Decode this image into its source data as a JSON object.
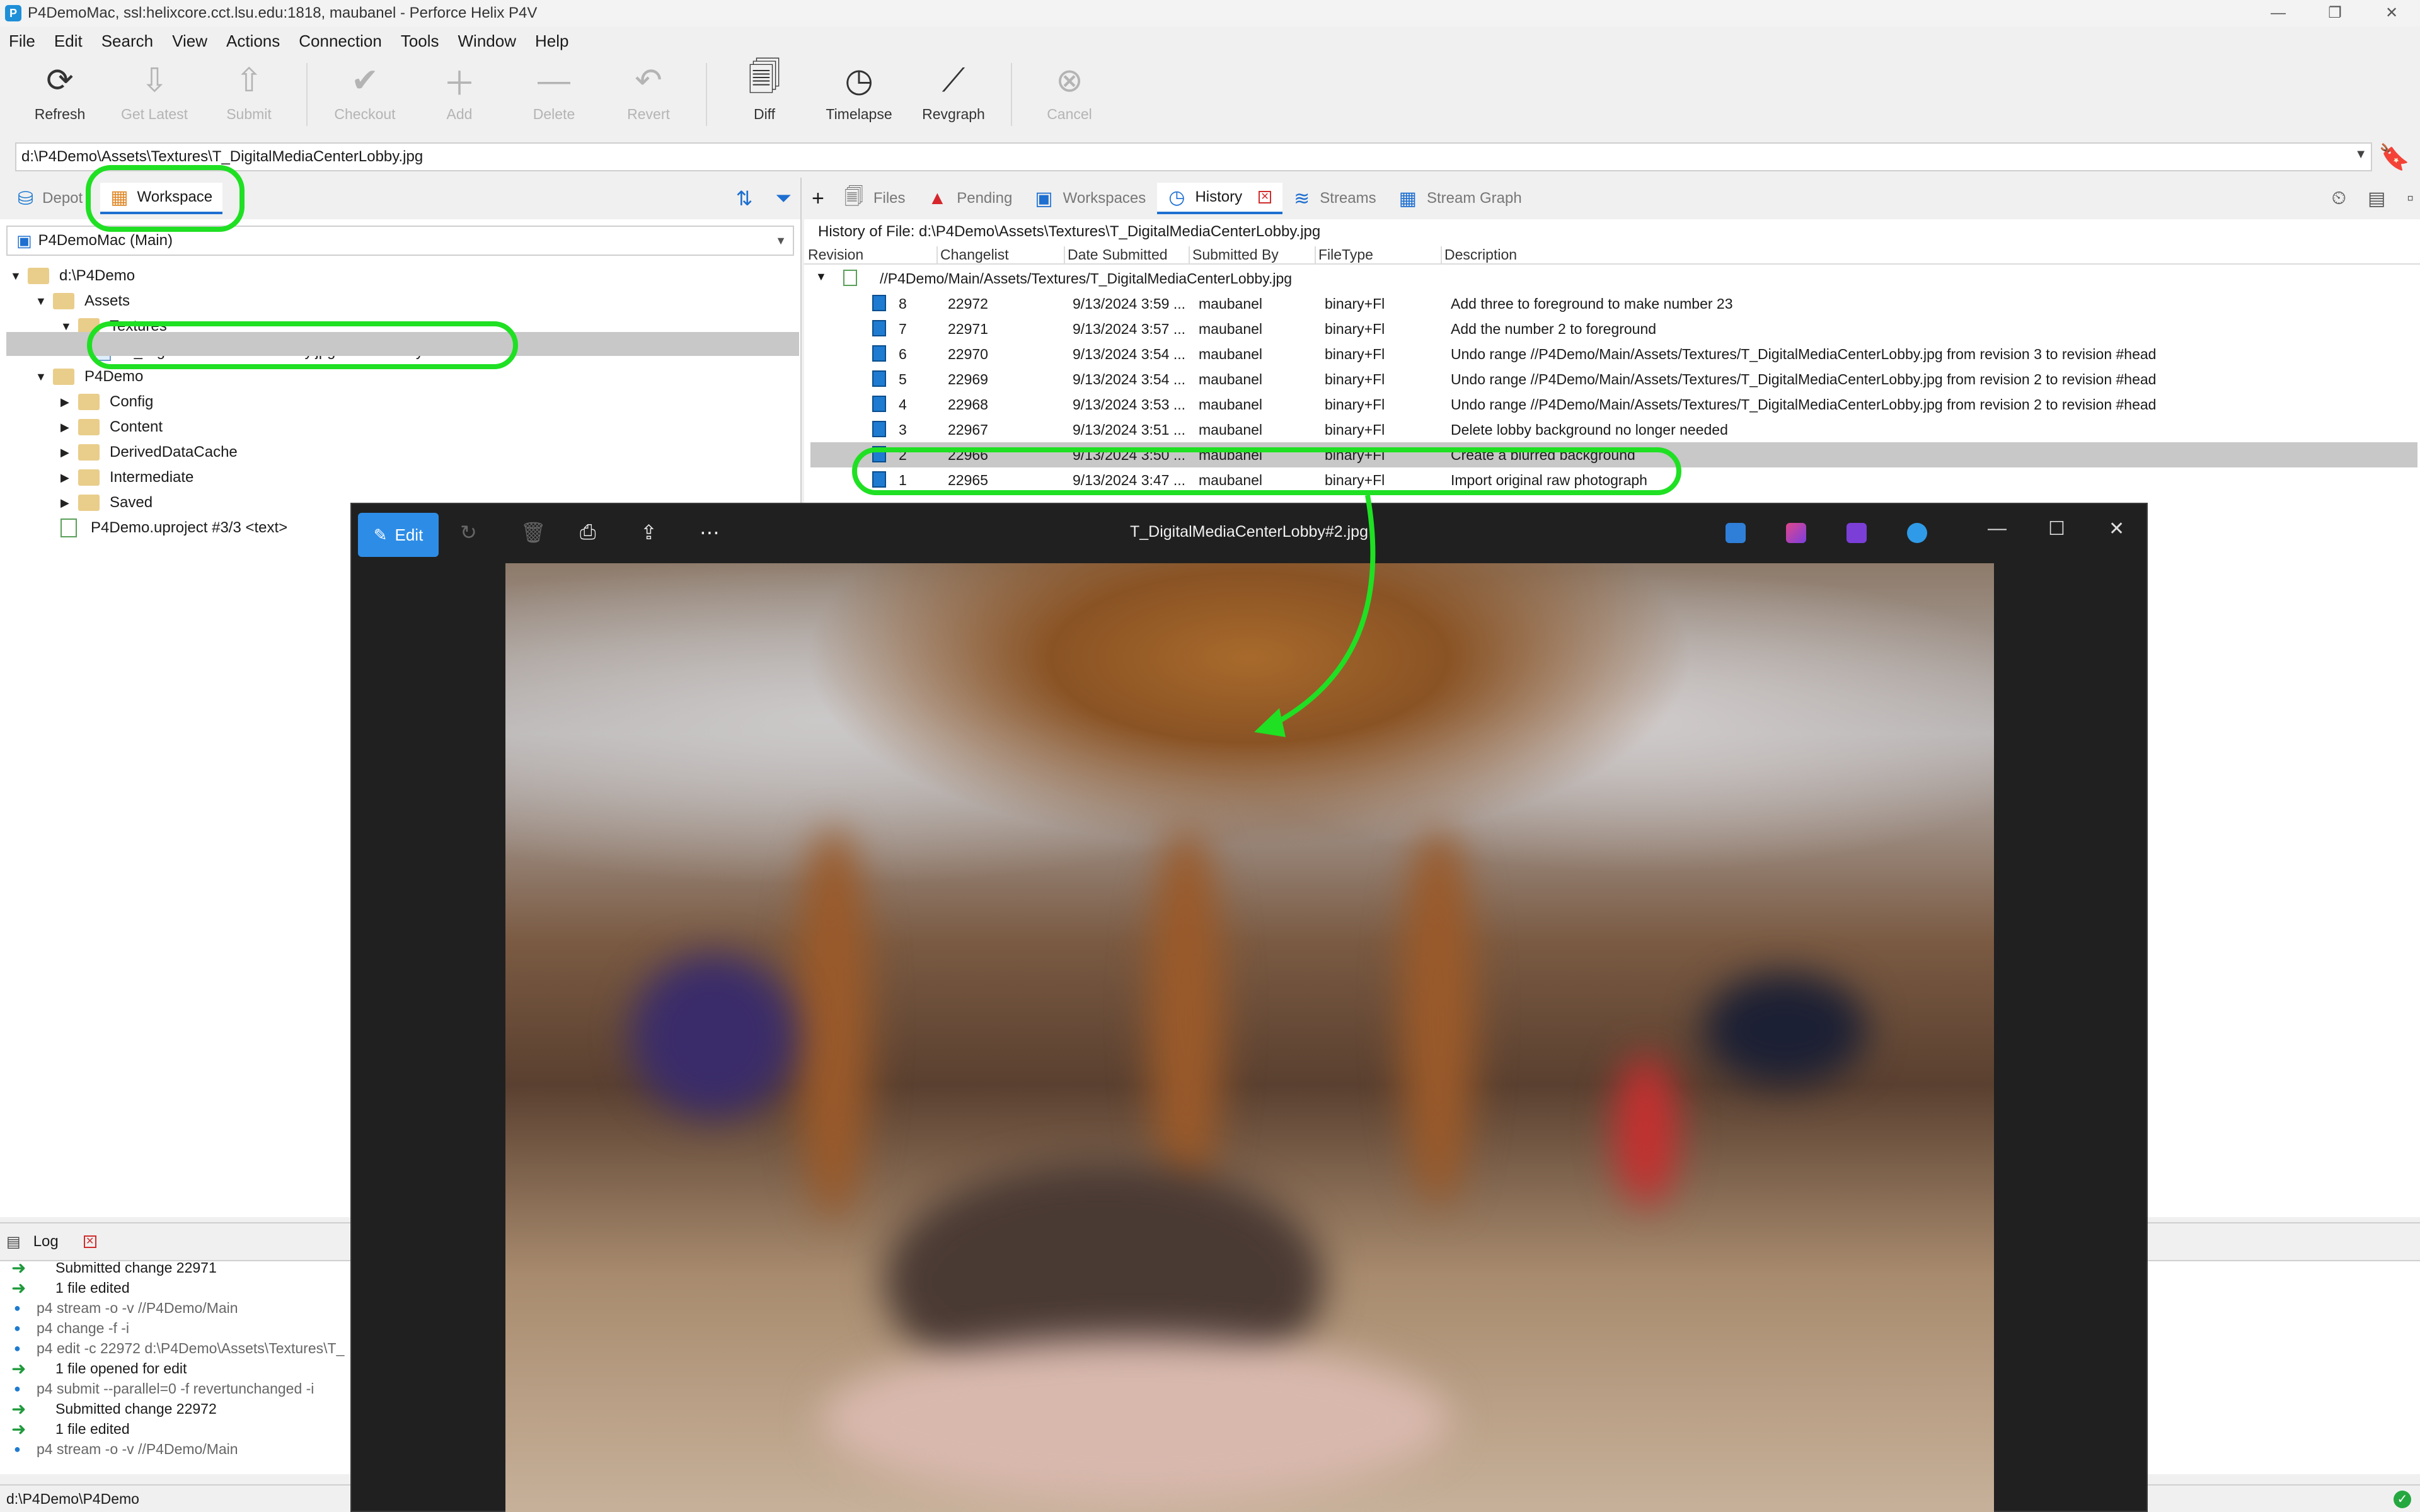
{
  "window": {
    "app_icon_letter": "P",
    "title": "P4DemoMac,  ssl:helixcore.cct.lsu.edu:1818,  maubanel - Perforce Helix P4V"
  },
  "menu": [
    "File",
    "Edit",
    "Search",
    "View",
    "Actions",
    "Connection",
    "Tools",
    "Window",
    "Help"
  ],
  "toolbar": {
    "refresh": "Refresh",
    "get_latest": "Get Latest",
    "submit": "Submit",
    "checkout": "Checkout",
    "add": "Add",
    "delete": "Delete",
    "revert": "Revert",
    "diff": "Diff",
    "timelapse": "Timelapse",
    "revgraph": "Revgraph",
    "cancel": "Cancel"
  },
  "path_bar": {
    "value": "d:\\P4Demo\\Assets\\Textures\\T_DigitalMediaCenterLobby.jpg"
  },
  "left_panel": {
    "tabs": [
      "Depot",
      "Workspace"
    ],
    "active_tab": "Workspace",
    "workspace_select": "P4DemoMac (Main)",
    "tree": [
      {
        "label": "d:\\P4Demo",
        "level": 0,
        "expanded": true,
        "kind": "folder"
      },
      {
        "label": "Assets",
        "level": 1,
        "expanded": true,
        "kind": "folder"
      },
      {
        "label": "Textures",
        "level": 2,
        "expanded": true,
        "kind": "folder"
      },
      {
        "label": "T_DigitalMediaCenterLobby.jpg #8/8 <binary+Fl>",
        "level": 3,
        "kind": "file",
        "selected": true
      },
      {
        "label": "P4Demo",
        "level": 1,
        "expanded": true,
        "kind": "folder"
      },
      {
        "label": "Config",
        "level": 2,
        "expanded": false,
        "kind": "folder"
      },
      {
        "label": "Content",
        "level": 2,
        "expanded": false,
        "kind": "folder"
      },
      {
        "label": "DerivedDataCache",
        "level": 2,
        "expanded": false,
        "kind": "folder"
      },
      {
        "label": "Intermediate",
        "level": 2,
        "expanded": false,
        "kind": "folder"
      },
      {
        "label": "Saved",
        "level": 2,
        "expanded": false,
        "kind": "folder"
      },
      {
        "label": "P4Demo.uproject #3/3 <text>",
        "level": 2,
        "kind": "file-text"
      }
    ]
  },
  "right_panel": {
    "tabs": [
      {
        "label": "Files",
        "icon": "files-icon"
      },
      {
        "label": "Pending",
        "icon": "pending-icon"
      },
      {
        "label": "Workspaces",
        "icon": "workspaces-icon"
      },
      {
        "label": "History",
        "icon": "history-icon",
        "active": true
      },
      {
        "label": "Streams",
        "icon": "streams-icon"
      },
      {
        "label": "Stream Graph",
        "icon": "stream-graph-icon"
      }
    ],
    "history_of_file": "History of File:  d:\\P4Demo\\Assets\\Textures\\T_DigitalMediaCenterLobby.jpg",
    "columns": [
      "Revision",
      "Changelist",
      "Date Submitted",
      "Submitted By",
      "FileType",
      "Description"
    ],
    "depot_path": "//P4Demo/Main/Assets/Textures/T_DigitalMediaCenterLobby.jpg",
    "rows": [
      {
        "rev": "8",
        "cl": "22972",
        "date": "9/13/2024 3:59 ...",
        "by": "maubanel",
        "type": "binary+Fl",
        "desc": "Add three to foreground to make number 23"
      },
      {
        "rev": "7",
        "cl": "22971",
        "date": "9/13/2024 3:57 ...",
        "by": "maubanel",
        "type": "binary+Fl",
        "desc": "Add the number 2 to foreground"
      },
      {
        "rev": "6",
        "cl": "22970",
        "date": "9/13/2024 3:54 ...",
        "by": "maubanel",
        "type": "binary+Fl",
        "desc": "Undo range //P4Demo/Main/Assets/Textures/T_DigitalMediaCenterLobby.jpg from revision 3 to revision #head"
      },
      {
        "rev": "5",
        "cl": "22969",
        "date": "9/13/2024 3:54 ...",
        "by": "maubanel",
        "type": "binary+Fl",
        "desc": "Undo range //P4Demo/Main/Assets/Textures/T_DigitalMediaCenterLobby.jpg from revision 2 to revision #head"
      },
      {
        "rev": "4",
        "cl": "22968",
        "date": "9/13/2024 3:53 ...",
        "by": "maubanel",
        "type": "binary+Fl",
        "desc": "Undo range //P4Demo/Main/Assets/Textures/T_DigitalMediaCenterLobby.jpg from revision 2 to revision #head"
      },
      {
        "rev": "3",
        "cl": "22967",
        "date": "9/13/2024 3:51 ...",
        "by": "maubanel",
        "type": "binary+Fl",
        "desc": "Delete lobby background no longer needed"
      },
      {
        "rev": "2",
        "cl": "22966",
        "date": "9/13/2024 3:50 ...",
        "by": "maubanel",
        "type": "binary+Fl",
        "desc": "Create a blurred background",
        "selected": true
      },
      {
        "rev": "1",
        "cl": "22965",
        "date": "9/13/2024 3:47 ...",
        "by": "maubanel",
        "type": "binary+Fl",
        "desc": "Import original raw photograph"
      }
    ]
  },
  "log": {
    "tab": "Log",
    "lines": [
      {
        "kind": "ok",
        "text": "Submitted change 22971"
      },
      {
        "kind": "ok",
        "text": "1 file edited"
      },
      {
        "kind": "cmd",
        "text": "p4 stream -o -v //P4Demo/Main"
      },
      {
        "kind": "cmd",
        "text": "p4 change -f -i"
      },
      {
        "kind": "cmd",
        "text": "p4 edit -c 22972 d:\\P4Demo\\Assets\\Textures\\T_"
      },
      {
        "kind": "ok",
        "text": "1 file opened for edit"
      },
      {
        "kind": "cmd",
        "text": "p4 submit --parallel=0 -f revertunchanged -i"
      },
      {
        "kind": "ok",
        "text": "Submitted change 22972"
      },
      {
        "kind": "ok",
        "text": "1 file edited"
      },
      {
        "kind": "cmd",
        "text": "p4 stream -o -v //P4Demo/Main"
      }
    ]
  },
  "status_bar": {
    "path": "d:\\P4Demo\\P4Demo"
  },
  "photo_viewer": {
    "edit_label": "Edit",
    "title": "T_DigitalMediaCenterLobby#2.jpg"
  },
  "colors": {
    "annotation": "#1fe023",
    "accent": "#1e6fd0",
    "viewer_bg": "#202020"
  }
}
